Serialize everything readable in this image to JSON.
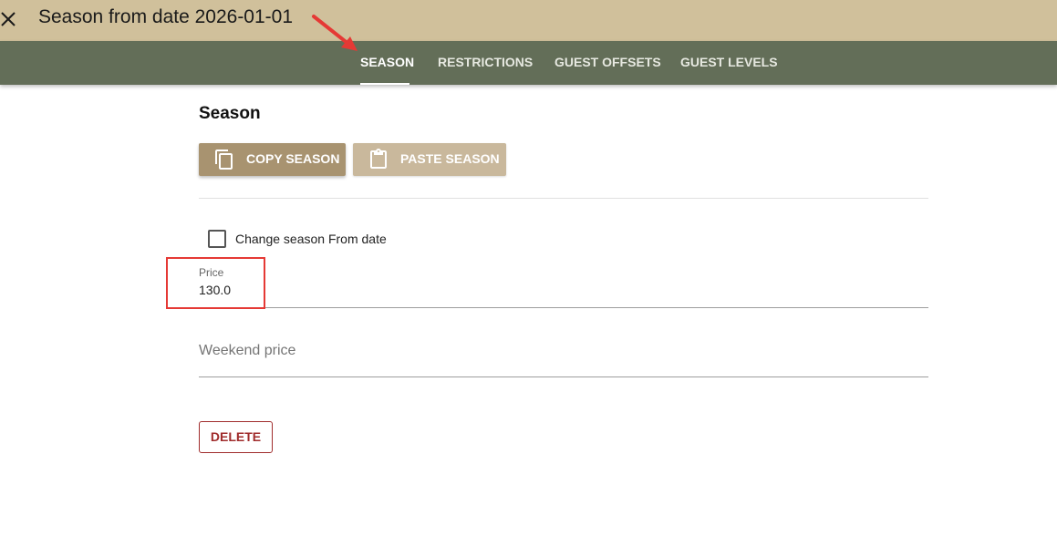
{
  "header": {
    "title": "Season from date 2026-01-01",
    "close_icon": "close-icon"
  },
  "tabs": [
    {
      "label": "SEASON",
      "active": true
    },
    {
      "label": "RESTRICTIONS",
      "active": false
    },
    {
      "label": "GUEST OFFSETS",
      "active": false
    },
    {
      "label": "GUEST LEVELS",
      "active": false
    }
  ],
  "section": {
    "title": "Season",
    "copy_button": {
      "label": "COPY SEASON",
      "icon": "copy-icon"
    },
    "paste_button": {
      "label": "PASTE SEASON",
      "icon": "clipboard-icon"
    }
  },
  "form": {
    "change_from_date": {
      "label": "Change season From date",
      "checked": false
    },
    "price": {
      "label": "Price",
      "value": "130.0"
    },
    "weekend_price": {
      "placeholder": "Weekend price",
      "value": ""
    }
  },
  "actions": {
    "delete_label": "DELETE"
  },
  "colors": {
    "header_bg": "#d0c09b",
    "tabbar_bg": "#636e58",
    "primary_button": "#a89370",
    "disabled_button": "#c9b89c",
    "delete_accent": "#a02c2c",
    "annotation_red": "#e53935"
  }
}
